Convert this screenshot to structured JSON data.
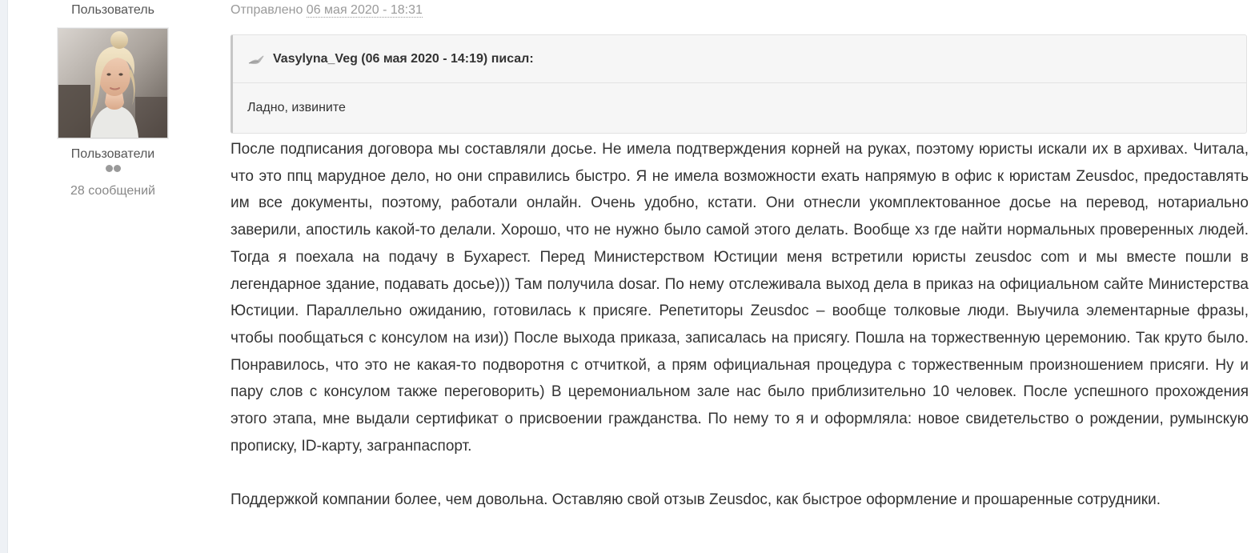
{
  "author": {
    "title": "Пользователь",
    "group": "Пользователи",
    "post_count": "28 сообщений",
    "avatar_icon": "user-avatar-photo"
  },
  "post": {
    "sent_label": "Отправлено",
    "sent_date": "06 мая 2020 - 18:31",
    "quote": {
      "icon": "quote-icon",
      "header": "Vasylyna_Veg (06 мая 2020 - 14:19) писал:",
      "text": "Ладно, извините"
    },
    "paragraph_1": "После подписания договора мы составляли досье. Не имела подтверждения корней на руках, поэтому юристы искали их в архивах. Читала, что это ппц марудное дело, но они справились быстро. Я не имела возможности ехать напрямую в офис к юристам Zeusdoc, предоставлять им все документы, поэтому, работали онлайн. Очень удобно, кстати. Они отнесли укомплектованное досье на перевод, нотариально заверили, апостиль какой-то делали. Хорошо, что не нужно было самой этого делать. Вообще хз где найти нормальных проверенных людей. Тогда я поехала на подачу в Бухарест. Перед Министерством Юстиции меня встретили юристы zeusdoc com и мы вместе пошли в легендарное здание, подавать досье))) Там получила dosar. По нему отслеживала выход дела в приказ на официальном сайте Министерства Юстиции. Параллельно ожиданию, готовилась к присяге. Репетиторы Zeusdoc – вообще толковые люди. Выучила элементарные фразы, чтобы пообщаться с консулом на изи)) После выхода приказа, записалась на присягу. Пошла на торжественную церемонию. Так круто было. Понравилось, что это не какая-то подворотня с отчиткой, а прям официальная процедура с торжественным произношением присяги. Ну и пару слов с консулом также переговорить) В церемониальном зале нас было приблизительно 10 человек. После успешного прохождения этого этапа, мне выдали сертификат о присвоении гражданства. По нему то я и оформляла: новое свидетельство о рождении, румынскую прописку, ID-карту, загранпаспорт.",
    "paragraph_2": "Поддержкой компании более, чем довольна. Оставляю свой отзыв Zeusdoc, как быстрое оформление и прошаренные сотрудники."
  },
  "colors": {
    "text": "#333333",
    "muted": "#9a9a9a",
    "quote_bg": "#f6f6f6",
    "quote_border": "#e2e2e2"
  }
}
